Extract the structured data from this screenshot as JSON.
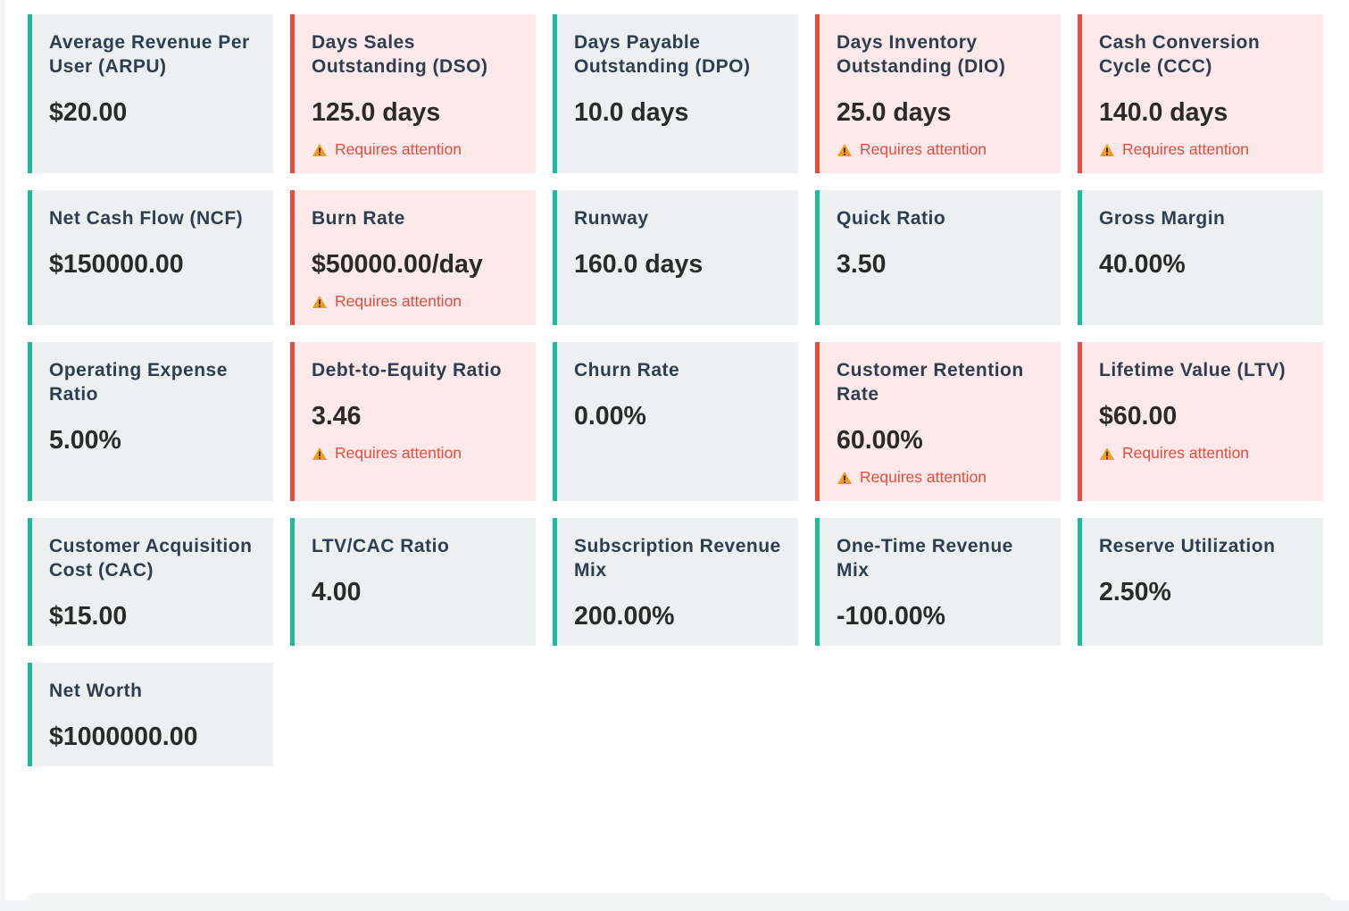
{
  "colors": {
    "ok_border": "#1abc9c",
    "ok_bg": "#ecf0f1",
    "alert_border": "#e74c3c",
    "alert_bg": "#fde8ea",
    "warning_text": "#e74c3c",
    "warning_icon": "#f39c12"
  },
  "warning_label": "Requires attention",
  "warning_icon_name": "warning-triangle-icon",
  "metrics": [
    {
      "title": "Average Revenue Per User (ARPU)",
      "value": "$20.00",
      "alert": false
    },
    {
      "title": "Days Sales Outstanding (DSO)",
      "value": "125.0 days",
      "alert": true
    },
    {
      "title": "Days Payable Outstanding (DPO)",
      "value": "10.0 days",
      "alert": false
    },
    {
      "title": "Days Inventory Outstanding (DIO)",
      "value": "25.0 days",
      "alert": true
    },
    {
      "title": "Cash Conversion Cycle (CCC)",
      "value": "140.0 days",
      "alert": true
    },
    {
      "title": "Net Cash Flow (NCF)",
      "value": "$150000.00",
      "alert": false
    },
    {
      "title": "Burn Rate",
      "value": "$50000.00/day",
      "alert": true
    },
    {
      "title": "Runway",
      "value": "160.0 days",
      "alert": false
    },
    {
      "title": "Quick Ratio",
      "value": "3.50",
      "alert": false
    },
    {
      "title": "Gross Margin",
      "value": "40.00%",
      "alert": false
    },
    {
      "title": "Operating Expense Ratio",
      "value": "5.00%",
      "alert": false
    },
    {
      "title": "Debt-to-Equity Ratio",
      "value": "3.46",
      "alert": true
    },
    {
      "title": "Churn Rate",
      "value": "0.00%",
      "alert": false
    },
    {
      "title": "Customer Retention Rate",
      "value": "60.00%",
      "alert": true
    },
    {
      "title": "Lifetime Value (LTV)",
      "value": "$60.00",
      "alert": true
    },
    {
      "title": "Customer Acquisition Cost (CAC)",
      "value": "$15.00",
      "alert": false
    },
    {
      "title": "LTV/CAC Ratio",
      "value": "4.00",
      "alert": false
    },
    {
      "title": "Subscription Revenue Mix",
      "value": "200.00%",
      "alert": false
    },
    {
      "title": "One-Time Revenue Mix",
      "value": "-100.00%",
      "alert": false
    },
    {
      "title": "Reserve Utilization",
      "value": "2.50%",
      "alert": false
    },
    {
      "title": "Net Worth",
      "value": "$1000000.00",
      "alert": false
    }
  ]
}
